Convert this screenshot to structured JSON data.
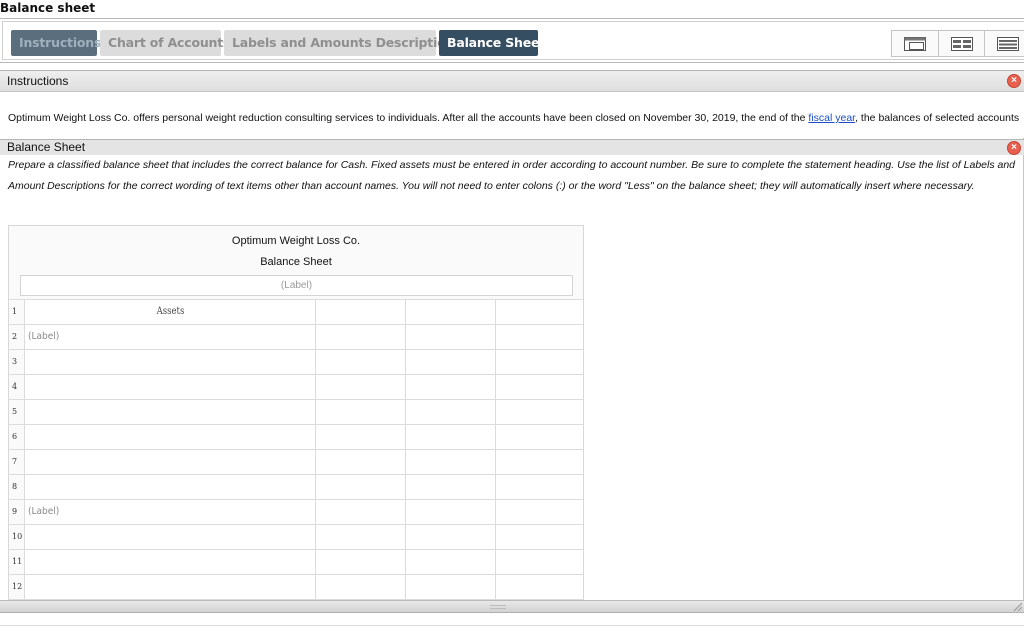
{
  "window": {
    "title": "Balance sheet"
  },
  "tabs": [
    {
      "label": "Instructions"
    },
    {
      "label": "Chart of Accounts"
    },
    {
      "label": "Labels and Amounts Descriptions"
    },
    {
      "label": "Balance Sheet"
    }
  ],
  "view_buttons": [
    "single-pane-view-icon",
    "split-view-icon",
    "list-view-icon"
  ],
  "instructions_panel": {
    "title": "Instructions",
    "text_before_link": "Optimum Weight Loss Co. offers personal weight reduction consulting services to individuals. After all the accounts have been closed on November 30, 2019, the end of the ",
    "link_text": "fiscal year",
    "text_after_link": ", the balances of selected accounts"
  },
  "balance_sheet_panel": {
    "title": "Balance Sheet",
    "description": "Prepare a classified balance sheet that includes the correct balance for Cash. Fixed assets must be entered in order according to account number. Be sure to complete the statement heading. Use the list of Labels and Amount Descriptions for the correct wording of text items other than account names. You will not need to enter colons (:) or the word \"Less\" on the balance sheet; they will automatically insert where necessary."
  },
  "sheet": {
    "company": "Optimum Weight Loss Co.",
    "statement": "Balance Sheet",
    "date_placeholder": "(Label)",
    "rows": [
      {
        "num": "1",
        "label": "Assets",
        "kind": "heading"
      },
      {
        "num": "2",
        "label": "(Label)",
        "kind": "placeholder"
      },
      {
        "num": "3",
        "label": "",
        "kind": "empty"
      },
      {
        "num": "4",
        "label": "",
        "kind": "empty"
      },
      {
        "num": "5",
        "label": "",
        "kind": "empty"
      },
      {
        "num": "6",
        "label": "",
        "kind": "empty"
      },
      {
        "num": "7",
        "label": "",
        "kind": "empty"
      },
      {
        "num": "8",
        "label": "",
        "kind": "empty"
      },
      {
        "num": "9",
        "label": "(Label)",
        "kind": "placeholder"
      },
      {
        "num": "10",
        "label": "",
        "kind": "empty"
      },
      {
        "num": "11",
        "label": "",
        "kind": "empty"
      },
      {
        "num": "12",
        "label": "",
        "kind": "empty"
      }
    ]
  },
  "colors": {
    "active_tab": "#364e62",
    "inactive_tab": "#dcdcdc",
    "close_button": "#e8604f",
    "link": "#1a4ec4"
  }
}
